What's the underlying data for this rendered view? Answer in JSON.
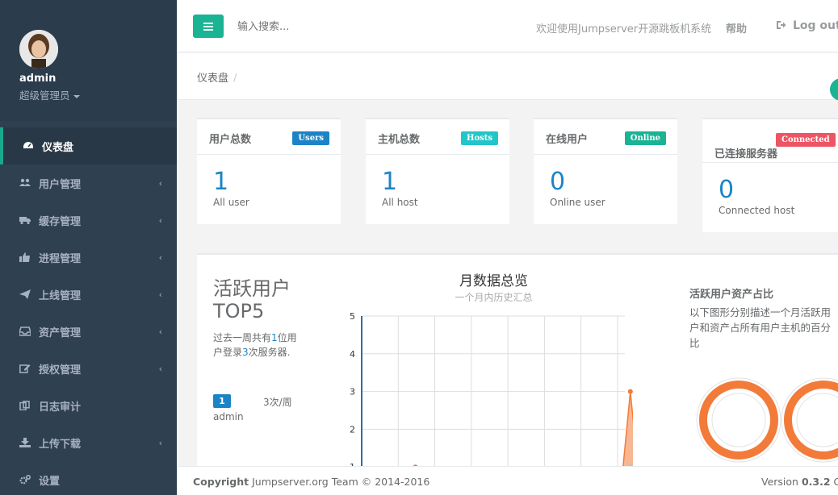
{
  "sidebar": {
    "user_name": "admin",
    "user_role": "超级管理员",
    "items": [
      {
        "label": "仪表盘",
        "icon": "dashboard-icon",
        "active": true,
        "has_arrow": false
      },
      {
        "label": "用户管理",
        "icon": "users-icon",
        "active": false,
        "has_arrow": true
      },
      {
        "label": "缓存管理",
        "icon": "truck-icon",
        "active": false,
        "has_arrow": true
      },
      {
        "label": "进程管理",
        "icon": "thumbs-up-icon",
        "active": false,
        "has_arrow": true
      },
      {
        "label": "上线管理",
        "icon": "paper-plane-icon",
        "active": false,
        "has_arrow": true
      },
      {
        "label": "资产管理",
        "icon": "inbox-icon",
        "active": false,
        "has_arrow": true
      },
      {
        "label": "授权管理",
        "icon": "edit-icon",
        "active": false,
        "has_arrow": true
      },
      {
        "label": "日志审计",
        "icon": "files-icon",
        "active": false,
        "has_arrow": false
      },
      {
        "label": "上传下载",
        "icon": "download-icon",
        "active": false,
        "has_arrow": true
      },
      {
        "label": "设置",
        "icon": "cogs-icon",
        "active": false,
        "has_arrow": false
      }
    ],
    "arrow_glyph": "‹"
  },
  "topbar": {
    "search_placeholder": "输入搜索...",
    "welcome": "欢迎使用Jumpserver开源跳板机系统",
    "help": "帮助",
    "logout": "Log out"
  },
  "breadcrumb": {
    "page": "仪表盘",
    "sep": "/"
  },
  "stats": [
    {
      "title": "用户总数",
      "badge": "Users",
      "value": "1",
      "sub": "All user"
    },
    {
      "title": "主机总数",
      "badge": "Hosts",
      "value": "1",
      "sub": "All host"
    },
    {
      "title": "在线用户",
      "badge": "Online",
      "value": "0",
      "sub": "Online user"
    },
    {
      "title": "已连接服务器",
      "badge": "Connected",
      "value": "0",
      "sub": "Connected host"
    }
  ],
  "top5": {
    "title": "活跃用户TOP5",
    "desc_prefix": "过去一周共有",
    "desc_users": "1",
    "desc_mid": "位用户登录",
    "desc_times": "3",
    "desc_suffix": "次服务器.",
    "rank": "1",
    "count": "3次/周",
    "user": "admin"
  },
  "chart_data": {
    "type": "area",
    "title": "月数据总览",
    "subtitle": "一个月内历史汇总",
    "ylim": [
      0,
      5
    ],
    "yticks": [
      "1",
      "2",
      "3",
      "4",
      "5"
    ],
    "grid": true,
    "series": [
      {
        "color": "#f27b3a",
        "peaks": [
          {
            "x": 2,
            "y": 1
          },
          {
            "x": 8,
            "y": 3
          }
        ]
      },
      {
        "color": "#87cefa",
        "peaks": [
          {
            "x": 8,
            "y": 1
          }
        ]
      }
    ]
  },
  "side": {
    "title": "活跃用户资产占比",
    "desc": "以下图形分别描述一个月活跃用户和资产占所有用户主机的百分比"
  },
  "footer": {
    "copyright_bold": "Copyright",
    "copyright_rest": " Jumpserver.org Team © 2014-2016",
    "version_label": "Version ",
    "version_num": "0.3.2",
    "version_tail": " GPL"
  },
  "colors": {
    "sidebar": "#2f4050",
    "accent": "#1ab394",
    "blue": "#1c84c6",
    "chart_orange": "#f27b3a"
  }
}
